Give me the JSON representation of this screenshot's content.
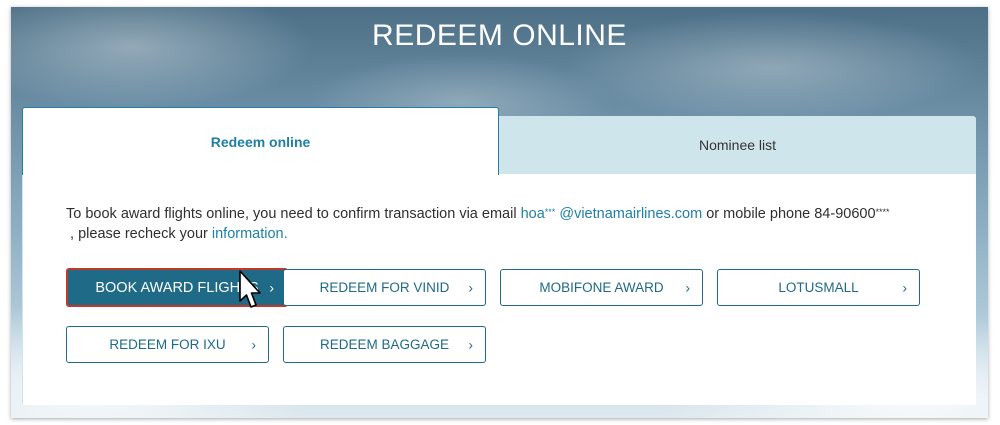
{
  "header": {
    "title": "REDEEM ONLINE"
  },
  "tabs": [
    {
      "label": "Redeem online",
      "active": true
    },
    {
      "label": "Nominee list",
      "active": false
    }
  ],
  "message": {
    "text_before_email": "To book award flights online, you need to confirm transaction via email",
    "email_prefix": "hoa",
    "email_mask": "***",
    "email_domain": "@vietnamairlines.com",
    "text_phone": "or mobile phone 84-90600",
    "phone_mask": "****",
    "text_recheck": ", please recheck your",
    "info_link": "information."
  },
  "buttons": [
    {
      "label": "BOOK AWARD FLIGHTS",
      "chevron": "›",
      "primary": true
    },
    {
      "label": "REDEEM FOR VINID",
      "chevron": "›"
    },
    {
      "label": "MOBIFONE AWARD",
      "chevron": "›"
    },
    {
      "label": "LOTUSMALL",
      "chevron": "›"
    },
    {
      "label": "REDEEM FOR IXU",
      "chevron": "›"
    },
    {
      "label": "REDEEM BAGGAGE",
      "chevron": "›"
    }
  ],
  "colors": {
    "accent": "#1f7fa5",
    "button_primary_bg": "#1f6a86",
    "button_primary_border": "#c0392b",
    "tab_inactive_bg": "#cfe5ec"
  },
  "icons": {
    "cursor": "mouse-pointer-icon",
    "chevron": "chevron-right-icon"
  }
}
